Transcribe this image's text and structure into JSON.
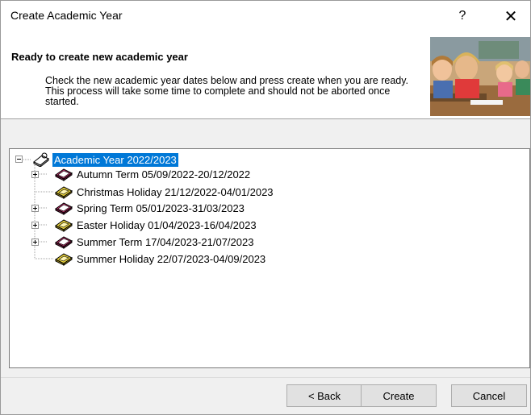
{
  "window": {
    "title": "Create Academic Year",
    "help_label": "?",
    "close_label": "✕"
  },
  "header": {
    "title": "Ready to create new academic year",
    "description": "Check the new academic year dates below and press create when you are ready. This process will take some time to complete and should not be aborted once started."
  },
  "tree": {
    "root": {
      "label": "Academic Year 2022/2023",
      "icon": "calendar-book-icon",
      "selected": true,
      "expanded": true
    },
    "items": [
      {
        "label": "Autumn Term 05/09/2022-20/12/2022",
        "kind": "term",
        "icon": "term-calendar-icon",
        "expandable": true
      },
      {
        "label": "Christmas Holiday 21/12/2022-04/01/2023",
        "kind": "holiday",
        "icon": "holiday-calendar-icon",
        "expandable": false
      },
      {
        "label": "Spring Term 05/01/2023-31/03/2023",
        "kind": "term",
        "icon": "term-calendar-icon",
        "expandable": true
      },
      {
        "label": "Easter Holiday 01/04/2023-16/04/2023",
        "kind": "holiday",
        "icon": "holiday-calendar-icon",
        "expandable": true
      },
      {
        "label": "Summer Term 17/04/2023-21/07/2023",
        "kind": "term",
        "icon": "term-calendar-icon",
        "expandable": true
      },
      {
        "label": "Summer Holiday 22/07/2023-04/09/2023",
        "kind": "holiday",
        "icon": "holiday-calendar-icon",
        "expandable": false
      }
    ]
  },
  "buttons": {
    "back": "< Back",
    "create": "Create",
    "cancel": "Cancel"
  },
  "colors": {
    "selection": "#0078d7",
    "term_icon": "#c0306a",
    "holiday_icon": "#e8d23a"
  }
}
